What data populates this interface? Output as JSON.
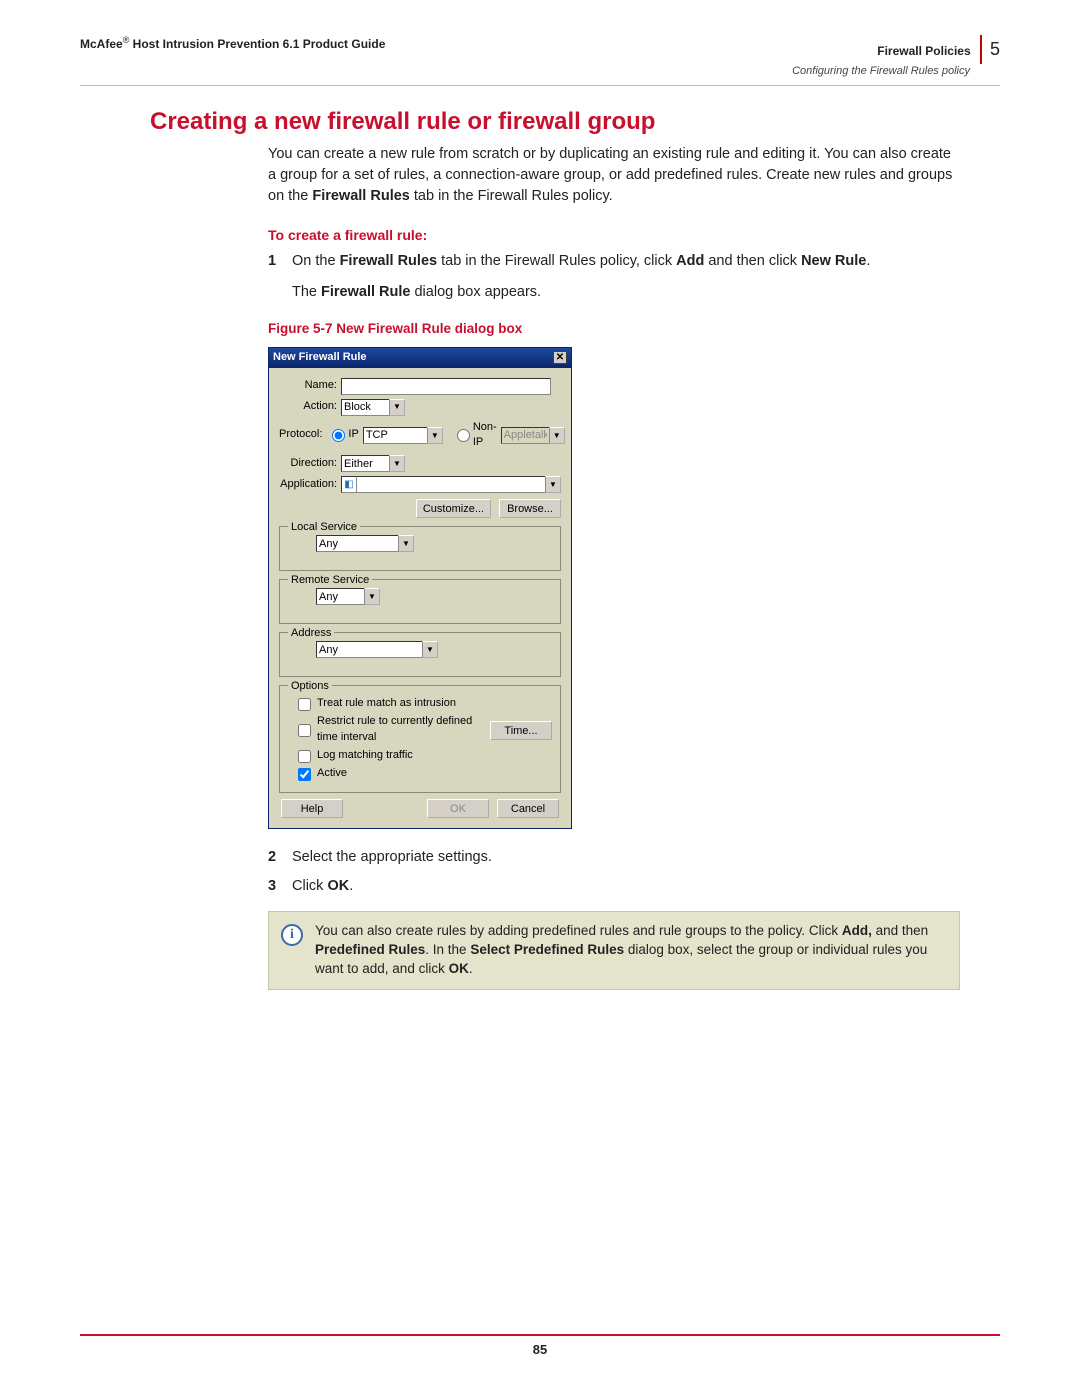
{
  "header": {
    "brand": "McAfee",
    "reg": "®",
    "guide": "Host Intrusion Prevention 6.1 Product Guide",
    "policies": "Firewall Policies",
    "chapter_num": "5",
    "subtitle": "Configuring the Firewall Rules policy"
  },
  "heading": "Creating a new firewall rule or firewall group",
  "intro_parts": {
    "p1a": "You can create a new rule from scratch or by duplicating an existing rule and editing it. You can also create a group for a set of rules, a connection-aware group, or add predefined rules. Create new rules and groups on the ",
    "p1b": "Firewall Rules",
    "p1c": " tab in the Firewall Rules policy."
  },
  "sub1": "To create a firewall rule:",
  "step1": {
    "num": "1",
    "a": "On the ",
    "b": "Firewall Rules",
    "c": " tab in the Firewall Rules policy, click ",
    "d": "Add",
    "e": " and then click ",
    "f": "New Rule",
    "g": "."
  },
  "appears": {
    "a": "The ",
    "b": "Firewall Rule",
    "c": " dialog box appears."
  },
  "fig_caption": "Figure 5-7  New Firewall Rule dialog box",
  "dialog": {
    "title": "New Firewall Rule",
    "close": "✕",
    "labels": {
      "name": "Name:",
      "action": "Action:",
      "protocol": "Protocol:",
      "direction": "Direction:",
      "application": "Application:",
      "ip": "IP",
      "nonip": "Non-IP",
      "appletalk": "Appletalk"
    },
    "values": {
      "action": "Block",
      "tcp": "TCP",
      "direction": "Either",
      "any": "Any"
    },
    "buttons": {
      "customize": "Customize...",
      "browse": "Browse...",
      "time": "Time...",
      "help": "Help",
      "ok": "OK",
      "cancel": "Cancel"
    },
    "groups": {
      "local": "Local Service",
      "remote": "Remote Service",
      "address": "Address",
      "options": "Options"
    },
    "options": {
      "intrusion": "Treat rule match as intrusion",
      "restrict": "Restrict rule to currently defined time interval",
      "log": "Log matching traffic",
      "active": "Active"
    },
    "dropdown_arrow": "▼"
  },
  "step2": {
    "num": "2",
    "text": "Select the appropriate settings."
  },
  "step3": {
    "num": "3",
    "a": "Click ",
    "b": "OK",
    "c": "."
  },
  "note": {
    "a": "You can also create rules by adding predefined rules and rule groups to the policy. Click ",
    "b": "Add,",
    "c": " and then ",
    "d": "Predefined Rules",
    "e": ". In the ",
    "f": "Select Predefined Rules",
    "g": " dialog box, select the group or individual rules you want to add, and click ",
    "h": "OK",
    "i": "."
  },
  "page_num": "85"
}
